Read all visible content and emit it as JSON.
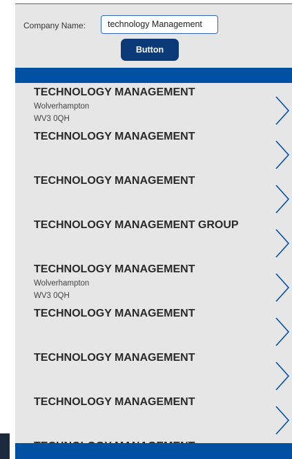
{
  "search": {
    "label": "Company Name:",
    "value": "technology Management",
    "button_label": "Button"
  },
  "results": [
    {
      "title": "TECHNOLOGY MANAGEMENT",
      "city": "Wolverhampton",
      "postcode": "WV3 0QH"
    },
    {
      "title": "TECHNOLOGY MANAGEMENT",
      "city": "",
      "postcode": ""
    },
    {
      "title": "TECHNOLOGY MANAGEMENT",
      "city": "",
      "postcode": ""
    },
    {
      "title": "TECHNOLOGY MANAGEMENT GROUP",
      "city": "",
      "postcode": ""
    },
    {
      "title": "TECHNOLOGY MANAGEMENT",
      "city": "Wolverhampton",
      "postcode": "WV3 0QH"
    },
    {
      "title": "TECHNOLOGY MANAGEMENT",
      "city": "",
      "postcode": ""
    },
    {
      "title": "TECHNOLOGY MANAGEMENT",
      "city": "",
      "postcode": ""
    },
    {
      "title": "TECHNOLOGY MANAGEMENT",
      "city": "",
      "postcode": ""
    },
    {
      "title": "TECHNOLOGY MANAGEMENT",
      "city": "",
      "postcode": ""
    }
  ],
  "icons": {
    "row_action": "chevron-right-icon"
  },
  "colors": {
    "accent": "#0050a4",
    "button": "#0a3a78",
    "panel": "#e6e6e6",
    "input_border": "#2f66c1"
  }
}
